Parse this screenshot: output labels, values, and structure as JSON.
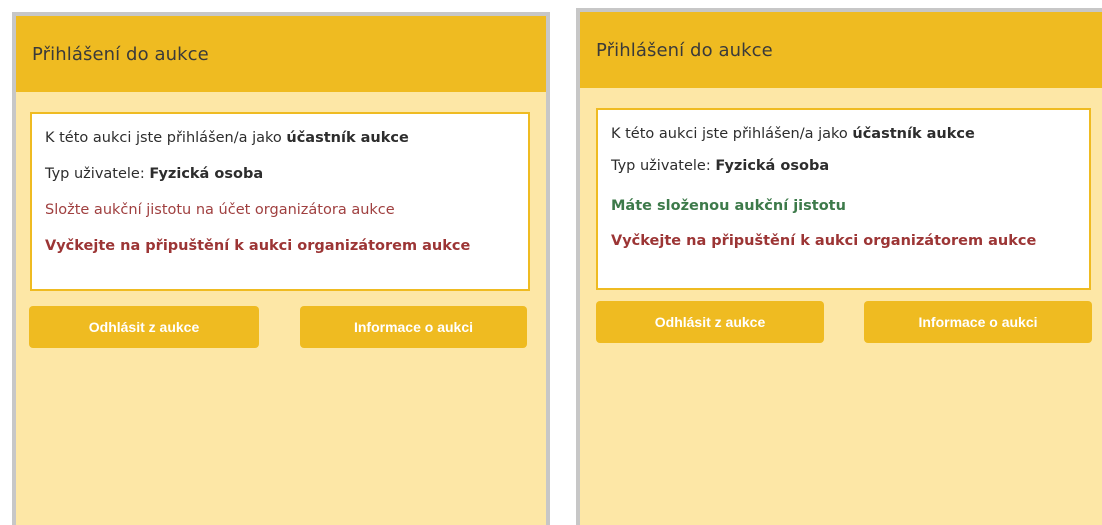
{
  "panels": [
    {
      "title": "Přihlášení do aukce",
      "line1_prefix": "K této aukci jste přihlášen/a jako ",
      "line1_role": "účastník aukce",
      "line2_prefix": "Typ uživatele: ",
      "line2_type": "Fyzická osoba",
      "line3": "Složte aukční jistotu na účet organizátora aukce",
      "line4": "Vyčkejte na připuštění k aukci organizátorem aukce",
      "logout_label": "Odhlásit z aukce",
      "info_label": "Informace o aukci"
    },
    {
      "title": "Přihlášení do aukce",
      "line1_prefix": "K této aukci jste přihlášen/a jako ",
      "line1_role": "účastník aukce",
      "line2_prefix": "Typ uživatele: ",
      "line2_type": "Fyzická osoba",
      "line3": "Máte složenou aukční jistotu",
      "line4": "Vyčkejte na připuštění k aukci organizátorem aukce",
      "logout_label": "Odhlásit z aukce",
      "info_label": "Informace o aukci"
    }
  ],
  "colors": {
    "header": "#efbb21",
    "panel_bg": "#fde7a6",
    "warning_text": "#a04040",
    "success_text": "#3d7a4a"
  }
}
